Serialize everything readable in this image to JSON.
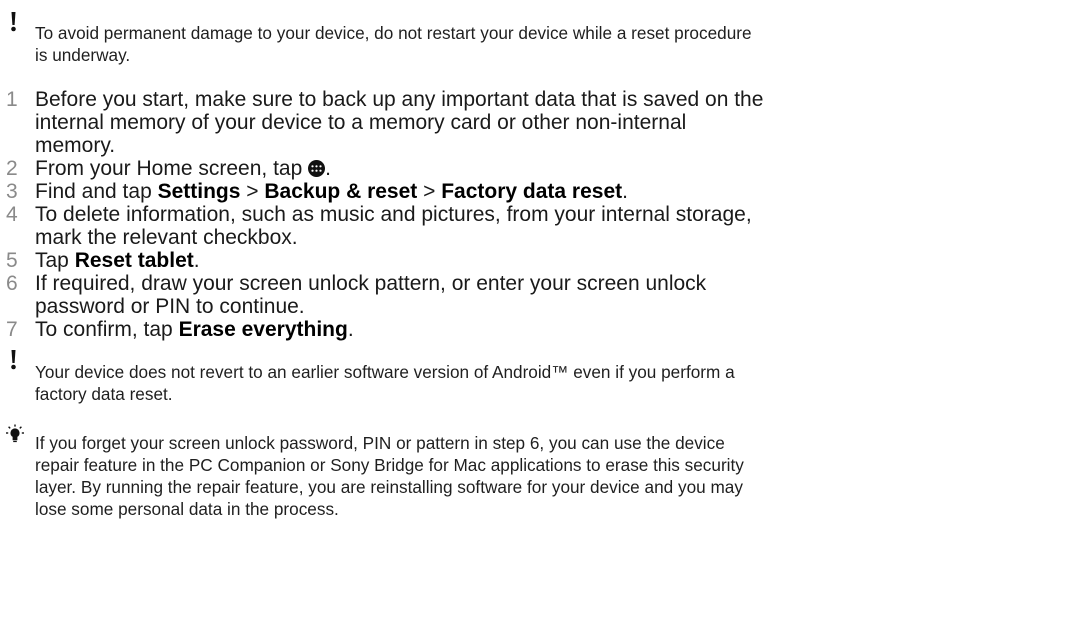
{
  "warning_top": {
    "icon": "exclamation-icon",
    "text_line1": "To avoid permanent damage to your device, do not restart your device while a reset procedure",
    "text_line2": "is underway."
  },
  "steps": [
    {
      "number": "1",
      "lines": [
        "Before you start, make sure to back up any important data that is saved on the",
        "internal memory of your device to a memory card or other non-internal",
        "memory."
      ]
    },
    {
      "number": "2",
      "before": "From your Home screen, tap ",
      "icon": "apps-icon",
      "after": "."
    },
    {
      "number": "3",
      "t1": "Find and tap ",
      "b1": "Settings",
      "t2": " > ",
      "b2": "Backup & reset",
      "t3": " > ",
      "b3": "Factory data reset",
      "t4": "."
    },
    {
      "number": "4",
      "lines": [
        "To delete information, such as music and pictures, from your internal storage,",
        "mark the relevant checkbox."
      ]
    },
    {
      "number": "5",
      "t1": "Tap ",
      "b1": "Reset tablet",
      "t2": "."
    },
    {
      "number": "6",
      "lines": [
        "If required, draw your screen unlock pattern, or enter your screen unlock",
        "password or PIN to continue."
      ]
    },
    {
      "number": "7",
      "t1": "To confirm, tap ",
      "b1": "Erase everything",
      "t2": "."
    }
  ],
  "warning_bottom": {
    "icon": "exclamation-icon",
    "text_line1": "Your device does not revert to an earlier software version of Android™ even if you perform a",
    "text_line2": "factory data reset."
  },
  "tip": {
    "icon": "lightbulb-icon",
    "lines": [
      "If you forget your screen unlock password, PIN or pattern in step 6, you can use the device",
      "repair feature in the PC Companion or Sony Bridge for Mac applications to erase this security",
      "layer. By running the repair feature, you are reinstalling software for your device and you may",
      "lose some personal data in the process."
    ]
  }
}
